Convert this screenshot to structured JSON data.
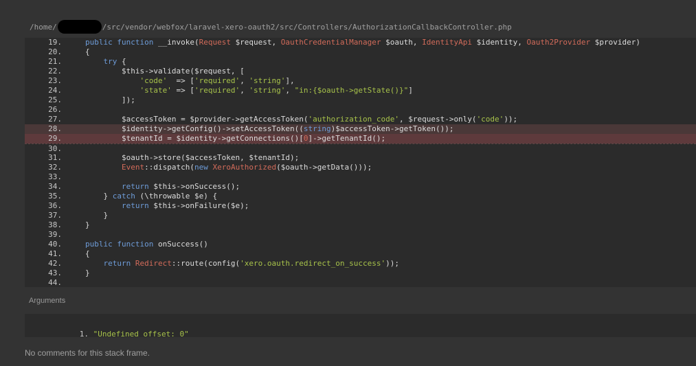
{
  "file_path": {
    "prefix": "/home/",
    "suffix": "/src/vendor/webfox/laravel-xero-oauth2/src/Controllers/AuthorizationCallbackController.php"
  },
  "code_lines": [
    {
      "n": "19.",
      "hl": "",
      "tokens": [
        [
          "kw",
          "public function "
        ],
        [
          "var",
          "__invoke("
        ],
        [
          "cls",
          "Request "
        ],
        [
          "var",
          "$request, "
        ],
        [
          "cls",
          "OauthCredentialManager "
        ],
        [
          "var",
          "$oauth, "
        ],
        [
          "cls",
          "IdentityApi "
        ],
        [
          "var",
          "$identity, "
        ],
        [
          "cls",
          "Oauth2Provider "
        ],
        [
          "var",
          "$provider)"
        ]
      ]
    },
    {
      "n": "20.",
      "hl": "",
      "tokens": [
        [
          "pun",
          "{"
        ]
      ]
    },
    {
      "n": "21.",
      "hl": "",
      "tokens": [
        [
          "kw",
          "    try "
        ],
        [
          "pun",
          "{"
        ]
      ]
    },
    {
      "n": "22.",
      "hl": "",
      "tokens": [
        [
          "var",
          "        $this->validate($request, ["
        ]
      ]
    },
    {
      "n": "23.",
      "hl": "",
      "tokens": [
        [
          "str",
          "            'code'  "
        ],
        [
          "var",
          "=> ["
        ],
        [
          "str",
          "'required'"
        ],
        [
          "var",
          ", "
        ],
        [
          "str",
          "'string'"
        ],
        [
          "var",
          "],"
        ]
      ]
    },
    {
      "n": "24.",
      "hl": "",
      "tokens": [
        [
          "str",
          "            'state' "
        ],
        [
          "var",
          "=> ["
        ],
        [
          "str",
          "'required'"
        ],
        [
          "var",
          ", "
        ],
        [
          "str",
          "'string'"
        ],
        [
          "var",
          ", "
        ],
        [
          "str",
          "\"in:{$oauth->getState()}\""
        ],
        [
          "var",
          "]"
        ]
      ]
    },
    {
      "n": "25.",
      "hl": "",
      "tokens": [
        [
          "var",
          "        ]);"
        ]
      ]
    },
    {
      "n": "26.",
      "hl": "",
      "tokens": []
    },
    {
      "n": "27.",
      "hl": "",
      "tokens": [
        [
          "var",
          "        $accessToken = $provider->getAccessToken("
        ],
        [
          "str",
          "'authorization_code'"
        ],
        [
          "var",
          ", $request->only("
        ],
        [
          "str",
          "'code'"
        ],
        [
          "var",
          "));"
        ]
      ]
    },
    {
      "n": "28.",
      "hl": "soft",
      "tokens": [
        [
          "var",
          "        $identity->getConfig()->setAccessToken(("
        ],
        [
          "kw",
          "string"
        ],
        [
          "var",
          ")$accessToken->getToken());"
        ]
      ]
    },
    {
      "n": "29.",
      "hl": "strong",
      "tokens": [
        [
          "var",
          "        $tenantId = $identity->getConnections()["
        ],
        [
          "cls",
          "0"
        ],
        [
          "var",
          "]->getTenantId();"
        ]
      ]
    },
    {
      "n": "30.",
      "hl": "border",
      "tokens": []
    },
    {
      "n": "31.",
      "hl": "",
      "tokens": [
        [
          "var",
          "        $oauth->store($accessToken, $tenantId);"
        ]
      ]
    },
    {
      "n": "32.",
      "hl": "",
      "tokens": [
        [
          "cls",
          "        Event"
        ],
        [
          "var",
          "::dispatch("
        ],
        [
          "kw",
          "new "
        ],
        [
          "cls",
          "XeroAuthorized"
        ],
        [
          "var",
          "($oauth->getData()));"
        ]
      ]
    },
    {
      "n": "33.",
      "hl": "",
      "tokens": []
    },
    {
      "n": "34.",
      "hl": "",
      "tokens": [
        [
          "kw",
          "        return "
        ],
        [
          "var",
          "$this->onSuccess();"
        ]
      ]
    },
    {
      "n": "35.",
      "hl": "",
      "tokens": [
        [
          "pun",
          "    } "
        ],
        [
          "kw",
          "catch "
        ],
        [
          "var",
          "(\\throwable $e) {"
        ]
      ]
    },
    {
      "n": "36.",
      "hl": "",
      "tokens": [
        [
          "kw",
          "        return "
        ],
        [
          "var",
          "$this->onFailure($e);"
        ]
      ]
    },
    {
      "n": "37.",
      "hl": "",
      "tokens": [
        [
          "pun",
          "    }"
        ]
      ]
    },
    {
      "n": "38.",
      "hl": "",
      "tokens": [
        [
          "pun",
          "}"
        ]
      ]
    },
    {
      "n": "39.",
      "hl": "",
      "tokens": []
    },
    {
      "n": "40.",
      "hl": "",
      "tokens": [
        [
          "kw",
          "public function "
        ],
        [
          "var",
          "onSuccess()"
        ]
      ]
    },
    {
      "n": "41.",
      "hl": "",
      "tokens": [
        [
          "pun",
          "{"
        ]
      ]
    },
    {
      "n": "42.",
      "hl": "",
      "tokens": [
        [
          "kw",
          "    return "
        ],
        [
          "cls",
          "Redirect"
        ],
        [
          "var",
          "::route(config("
        ],
        [
          "str",
          "'xero.oauth.redirect_on_success'"
        ],
        [
          "var",
          "));"
        ]
      ]
    },
    {
      "n": "43.",
      "hl": "",
      "tokens": [
        [
          "pun",
          "}"
        ]
      ]
    },
    {
      "n": "44.",
      "hl": "",
      "tokens": []
    }
  ],
  "arguments": {
    "title": "Arguments",
    "items": [
      {
        "index": "1.",
        "value": "\"Undefined offset: 0\""
      }
    ]
  },
  "no_comments_text": "No comments for this stack frame."
}
